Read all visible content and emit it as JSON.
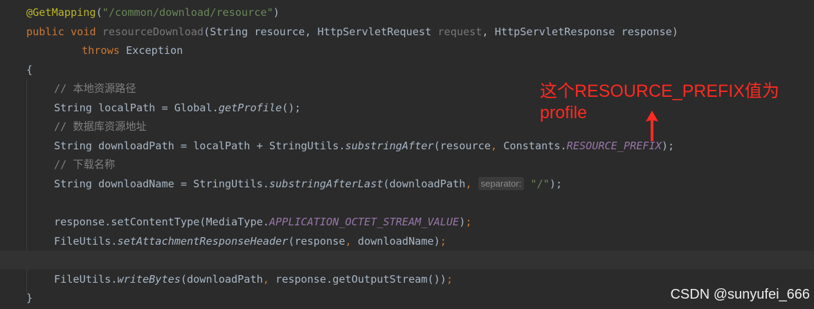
{
  "code": {
    "l1": {
      "annotation": "@GetMapping",
      "paren_open": "(",
      "path": "\"/common/download/resource\"",
      "paren_close": ")"
    },
    "l2": {
      "kw_public": "public",
      "kw_void": "void",
      "method": "resourceDownload",
      "params_a": "(String resource, HttpServletRequest ",
      "request_param": "request",
      "params_b": ", HttpServletResponse response)"
    },
    "l3": {
      "kw_throws": "throws",
      "exception": " Exception"
    },
    "l4": {
      "brace": "{"
    },
    "l5": {
      "comment": "// 本地资源路径"
    },
    "l6": {
      "a": "String localPath = Global.",
      "method": "getProfile",
      "b": "();"
    },
    "l7": {
      "comment": "// 数据库资源地址"
    },
    "l8": {
      "a": "String downloadPath = localPath + StringUtils.",
      "method": "substringAfter",
      "b": "(resource",
      "comma": ",",
      "c": " Constants.",
      "const": "RESOURCE_PREFIX",
      "d": ");"
    },
    "l9": {
      "comment": "// 下载名称"
    },
    "l10": {
      "a": "String downloadName = StringUtils.",
      "method": "substringAfterLast",
      "b": "(downloadPath",
      "comma": ",",
      "hint": "separator:",
      "str": "\"/\"",
      "c": ");"
    },
    "l12": {
      "a": "response.setContentType(MediaType.",
      "const": "APPLICATION_OCTET_STREAM_VALUE",
      "b": ")",
      "semi": ";"
    },
    "l13": {
      "a": "FileUtils.",
      "method": "setAttachmentResponseHeader",
      "b": "(response",
      "comma": ",",
      "c": " downloadName)",
      "semi": ";"
    },
    "l15": {
      "a": "FileUtils.",
      "method": "writeBytes",
      "b": "(downloadPath",
      "comma": ",",
      "c": " response.getOutputStream())",
      "semi": ";"
    },
    "l16": {
      "brace": "}"
    }
  },
  "annotation_note": {
    "line1": "这个RESOURCE_PREFIX值为",
    "line2": "profile",
    "color": "#ff2a22"
  },
  "watermark": "CSDN @sunyufei_666",
  "colors": {
    "background": "#2b2b2b",
    "keyword": "#cc7832",
    "string": "#6a8759",
    "comment": "#808080",
    "constant": "#9876aa",
    "annotation": "#bbb529",
    "text": "#a9b7c6"
  }
}
